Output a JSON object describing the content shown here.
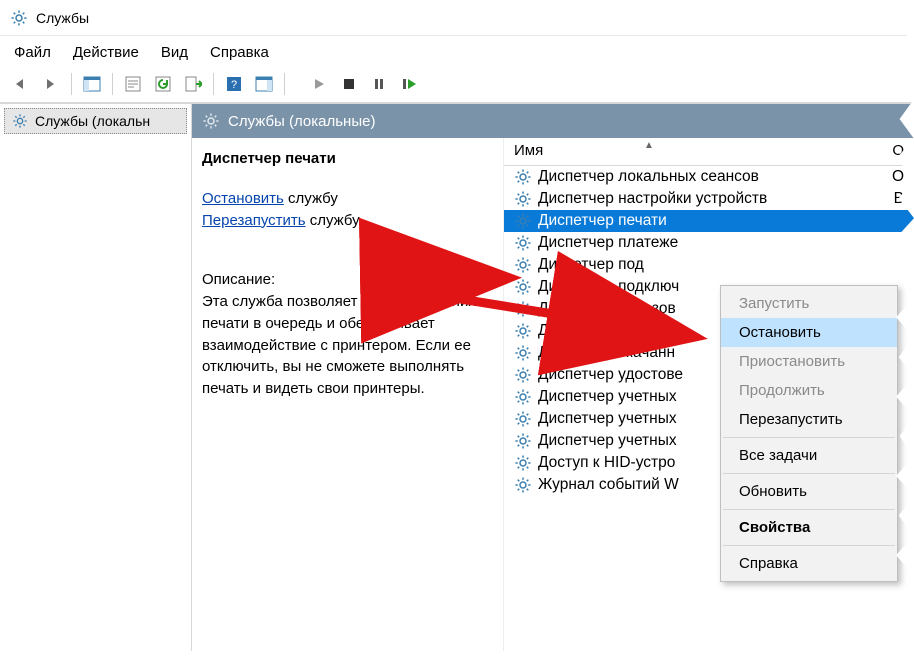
{
  "window": {
    "title": "Службы"
  },
  "menubar": [
    "Файл",
    "Действие",
    "Вид",
    "Справка"
  ],
  "tree": {
    "root": "Службы (локальн"
  },
  "pane": {
    "title": "Службы (локальные)"
  },
  "details": {
    "service_name": "Диспетчер печати",
    "stop_link": "Остановить",
    "stop_suffix": " службу",
    "restart_link": "Перезапустить",
    "restart_suffix": " службу",
    "desc_label": "Описание:",
    "description": "Эта служба позволяет ставить задания печати в очередь и обеспечивает взаимодействие с принтером. Если ее отключить, вы не сможете выполнять печать и видеть свои принтеры."
  },
  "columns": {
    "name": "Имя",
    "other": "О"
  },
  "services": [
    {
      "name": "Диспетчер локальных сеансов",
      "selected": false,
      "right": "О"
    },
    {
      "name": "Диспетчер настройки устройств",
      "selected": false,
      "right": "В"
    },
    {
      "name": "Диспетчер печати",
      "selected": true,
      "right": ""
    },
    {
      "name": "Диспетчер платеже",
      "selected": false,
      "right": ""
    },
    {
      "name": "Диспетчер под",
      "selected": false,
      "right": ""
    },
    {
      "name": "Диспетчер подключ",
      "selected": false,
      "right": ""
    },
    {
      "name": "Диспетчер пользов",
      "selected": false,
      "right": ""
    },
    {
      "name": "Диспетчер проверк",
      "selected": false,
      "right": ""
    },
    {
      "name": "Диспетчер скачанн",
      "selected": false,
      "right": ""
    },
    {
      "name": "Диспетчер удостове",
      "selected": false,
      "right": ""
    },
    {
      "name": "Диспетчер учетных",
      "selected": false,
      "right": ""
    },
    {
      "name": "Диспетчер учетных",
      "selected": false,
      "right": ""
    },
    {
      "name": "Диспетчер учетных",
      "selected": false,
      "right": ""
    },
    {
      "name": "Доступ к HID-устро",
      "selected": false,
      "right": ""
    },
    {
      "name": "Журнал событий W",
      "selected": false,
      "right": ""
    }
  ],
  "context_menu": [
    {
      "label": "Запустить",
      "state": "disabled"
    },
    {
      "label": "Остановить",
      "state": "hover"
    },
    {
      "label": "Приостановить",
      "state": "disabled"
    },
    {
      "label": "Продолжить",
      "state": "disabled"
    },
    {
      "label": "Перезапустить",
      "state": "normal"
    },
    {
      "sep": true
    },
    {
      "label": "Все задачи",
      "state": "normal"
    },
    {
      "sep": true
    },
    {
      "label": "Обновить",
      "state": "normal"
    },
    {
      "sep": true
    },
    {
      "label": "Свойства",
      "state": "bold"
    },
    {
      "sep": true
    },
    {
      "label": "Справка",
      "state": "normal"
    }
  ]
}
